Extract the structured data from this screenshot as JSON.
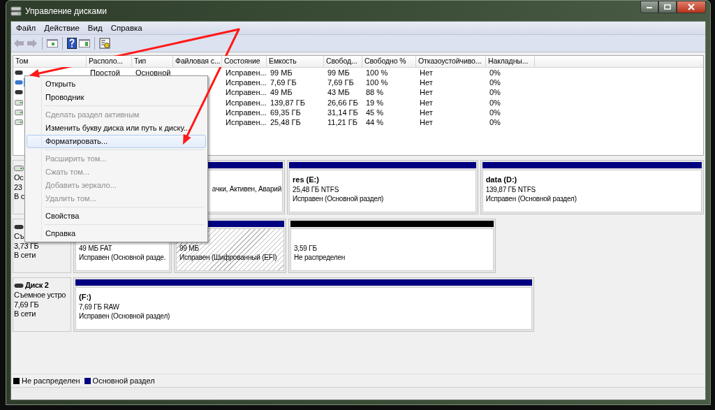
{
  "window": {
    "title": "Управление дисками"
  },
  "menu_bar": [
    "Файл",
    "Действие",
    "Вид",
    "Справка"
  ],
  "table": {
    "columns": [
      "Том",
      "Располо...",
      "Тип",
      "Файловая с...",
      "Состояние",
      "Емкость",
      "Свобод...",
      "Свободно %",
      "Отказоустойчиво...",
      "Накладны..."
    ],
    "rows": [
      {
        "kind": "removable",
        "selected": false,
        "layout": "Простой",
        "type": "Основной",
        "status": "Исправен...",
        "capacity": "99 МБ",
        "free": "99 МБ",
        "free_percent": "100 %",
        "fault_tolerance": "Нет",
        "overhead": "0%"
      },
      {
        "kind": "removable",
        "selected": true,
        "status": "Исправен...",
        "capacity": "7,69 ГБ",
        "free": "7,69 ГБ",
        "free_percent": "100 %",
        "fault_tolerance": "Нет",
        "overhead": "0%"
      },
      {
        "kind": "removable",
        "selected": false,
        "status": "Исправен...",
        "capacity": "49 МБ",
        "free": "43 МБ",
        "free_percent": "88 %",
        "fault_tolerance": "Нет",
        "overhead": "0%"
      },
      {
        "kind": "fixed",
        "selected": false,
        "status": "Исправен...",
        "capacity": "139,87 ГБ",
        "free": "26,66 ГБ",
        "free_percent": "19 %",
        "fault_tolerance": "Нет",
        "overhead": "0%"
      },
      {
        "kind": "fixed",
        "selected": false,
        "status": "Исправен...",
        "capacity": "69,35 ГБ",
        "free": "31,14 ГБ",
        "free_percent": "45 %",
        "fault_tolerance": "Нет",
        "overhead": "0%"
      },
      {
        "kind": "fixed",
        "selected": false,
        "status": "Исправен...",
        "capacity": "25,48 ГБ",
        "free": "11,21 ГБ",
        "free_percent": "44 %",
        "fault_tolerance": "Нет",
        "overhead": "0%"
      }
    ]
  },
  "disks": [
    {
      "kind": "fixed",
      "lines": [
        "Ос",
        "23",
        "В с"
      ],
      "segments": [
        {
          "kind": "primary",
          "lines": [
            "ачки, Активен, Аварий"
          ]
        },
        {
          "kind": "primary",
          "name": "res  (E:)",
          "lines": [
            "25,48 ГБ NTFS",
            "Исправен (Основной раздел)"
          ]
        },
        {
          "kind": "primary",
          "name": "data  (D:)",
          "lines": [
            "139,87 ГБ NTFS",
            "Исправен (Основной раздел)"
          ]
        }
      ]
    },
    {
      "kind": "removable",
      "lines": [
        "Съ",
        "3,73 ГБ",
        "В сети"
      ],
      "segments": [
        {
          "kind": "primary",
          "lines": [
            "49 МБ FAT",
            "Исправен (Основной разде."
          ]
        },
        {
          "kind": "efi",
          "lines": [
            "99 МБ",
            "Исправен (Шифрованный (EFI)"
          ]
        },
        {
          "kind": "unallocated",
          "lines": [
            "3,59 ГБ",
            "Не распределен"
          ]
        }
      ]
    },
    {
      "kind": "removable",
      "name": "Диск 2",
      "lines": [
        "Съемное устро",
        "7,69 ГБ",
        "В сети"
      ],
      "segments": [
        {
          "kind": "primary",
          "name": "(F:)",
          "lines": [
            "7,69 ГБ RAW",
            "Исправен (Основной раздел)"
          ]
        }
      ]
    }
  ],
  "legend": [
    {
      "label": "Не распределен",
      "color": "#000000"
    },
    {
      "label": "Основной раздел",
      "color": "#000080"
    }
  ],
  "context_menu": [
    {
      "kind": "item",
      "label": "Открыть",
      "disabled": false,
      "selected": false
    },
    {
      "kind": "item",
      "label": "Проводник",
      "disabled": false,
      "selected": false
    },
    {
      "kind": "separator"
    },
    {
      "kind": "item",
      "label": "Сделать раздел активным",
      "disabled": true,
      "selected": false
    },
    {
      "kind": "item",
      "label": "Изменить букву диска или путь к диску...",
      "disabled": false,
      "selected": false
    },
    {
      "kind": "item",
      "label": "Форматировать...",
      "disabled": false,
      "selected": true
    },
    {
      "kind": "separator"
    },
    {
      "kind": "item",
      "label": "Расширить том...",
      "disabled": true,
      "selected": false
    },
    {
      "kind": "item",
      "label": "Сжать том...",
      "disabled": true,
      "selected": false
    },
    {
      "kind": "item",
      "label": "Добавить зеркало...",
      "disabled": true,
      "selected": false
    },
    {
      "kind": "item",
      "label": "Удалить том...",
      "disabled": true,
      "selected": false
    },
    {
      "kind": "separator"
    },
    {
      "kind": "item",
      "label": "Свойства",
      "disabled": false,
      "selected": false
    },
    {
      "kind": "separator"
    },
    {
      "kind": "item",
      "label": "Справка",
      "disabled": false,
      "selected": false
    }
  ]
}
